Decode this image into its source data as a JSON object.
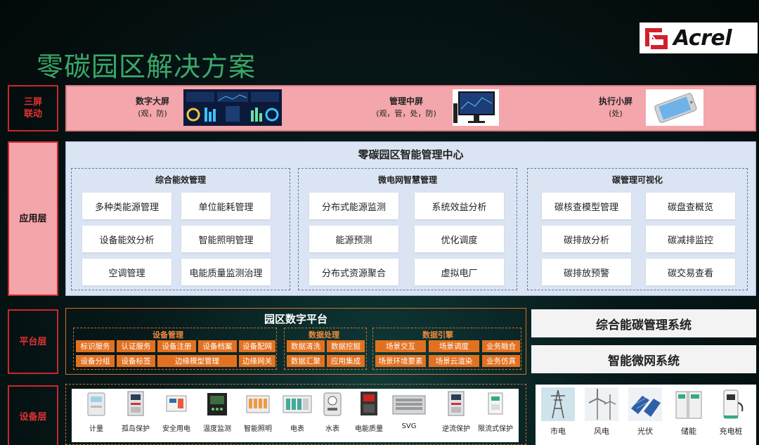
{
  "title": "零碳园区解决方案",
  "logo": "Acrel",
  "layers": {
    "screens_label": [
      "三屏",
      "联动"
    ],
    "app_label": "应用层",
    "platform_label": "平台层",
    "device_label": "设备层"
  },
  "screens": [
    {
      "title": "数字大屏",
      "sub": "(观，防)",
      "icon": "dashboard-screen-icon"
    },
    {
      "title": "管理中屏",
      "sub": "(观，管，处，防)",
      "icon": "desktop-monitor-icon"
    },
    {
      "title": "执行小屏",
      "sub": "(处)",
      "icon": "smartphone-icon"
    }
  ],
  "app": {
    "title": "零碳园区智能管理中心",
    "groups": [
      {
        "title": "综合能效管理",
        "items": [
          "多种类能源管理",
          "单位能耗管理",
          "设备能效分析",
          "智能照明管理",
          "空调管理",
          "电能质量监测治理"
        ]
      },
      {
        "title": "微电网智慧管理",
        "items": [
          "分布式能源监测",
          "系统效益分析",
          "能源预测",
          "优化调度",
          "分布式资源聚合",
          "虚拟电厂"
        ]
      },
      {
        "title": "碳管理可视化",
        "items": [
          "碳核查模型管理",
          "碳盘查概览",
          "碳排放分析",
          "碳减排监控",
          "碳排放预警",
          "碳交易查看"
        ]
      }
    ]
  },
  "platform": {
    "title": "园区数字平台",
    "device_mgmt": {
      "title": "设备管理",
      "items": [
        "标识服务",
        "认证服务",
        "设备注册",
        "设备档案",
        "设备配网",
        "设备分组",
        "设备标签",
        "边缘模型管理",
        "边缘网关"
      ]
    },
    "data_proc": {
      "title": "数据处理",
      "items": [
        "数据清洗",
        "数据挖掘",
        "数据汇聚",
        "应用集成"
      ]
    },
    "data_engine": {
      "title": "数据引擎",
      "items": [
        "场景交互",
        "场景调度",
        "业务融合",
        "场景环境要素",
        "场景云渲染",
        "业务仿真"
      ]
    }
  },
  "systems": [
    "综合能碳管理系统",
    "智能微网系统"
  ],
  "devices": [
    "计量",
    "孤岛保护",
    "安全用电",
    "温度监测",
    "智能照明",
    "电表",
    "水表",
    "电能质量",
    "SVG",
    "逆流保护",
    "限流式保护"
  ],
  "sources": [
    "市电",
    "风电",
    "光伏",
    "储能",
    "充电桩"
  ],
  "colors": {
    "title_green": "#3aa869",
    "label_red": "#e23232",
    "orange": "#e2711f",
    "pink": "#f3a6ab",
    "app_bg": "#dbe4f2"
  }
}
